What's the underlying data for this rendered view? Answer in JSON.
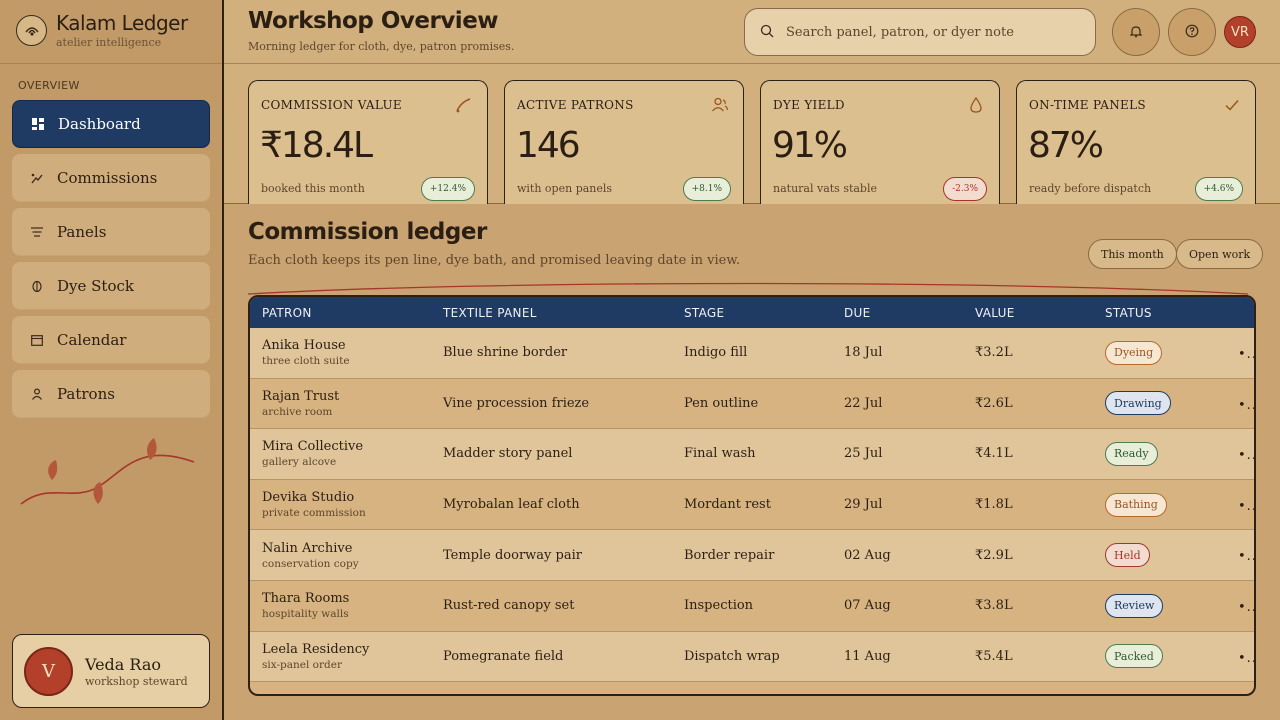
{
  "brand": {
    "name": "Kalam Ledger",
    "subtitle": "atelier intelligence"
  },
  "sidebar": {
    "section_label": "OVERVIEW",
    "items": [
      {
        "label": "Dashboard",
        "icon": "dashboard-icon",
        "active": true
      },
      {
        "label": "Commissions",
        "icon": "commissions-icon"
      },
      {
        "label": "Panels",
        "icon": "panels-icon"
      },
      {
        "label": "Dye Stock",
        "icon": "dye-stock-icon"
      },
      {
        "label": "Calendar",
        "icon": "calendar-icon"
      },
      {
        "label": "Patrons",
        "icon": "patrons-icon"
      }
    ]
  },
  "user": {
    "initial": "V",
    "name": "Veda Rao",
    "role": "workshop steward"
  },
  "header": {
    "title": "Workshop Overview",
    "subtitle": "Morning ledger for cloth, dye, patron promises.",
    "search_placeholder": "Search panel, patron, or dyer note",
    "avatar_initials": "VR"
  },
  "metrics": [
    {
      "label": "COMMISSION VALUE",
      "value": "₹18.4L",
      "note": "booked this month",
      "delta": "+12.4%",
      "trend": "up",
      "icon": "brush-icon"
    },
    {
      "label": "ACTIVE PATRONS",
      "value": "146",
      "note": "with open panels",
      "delta": "+8.1%",
      "trend": "up",
      "icon": "people-icon"
    },
    {
      "label": "DYE YIELD",
      "value": "91%",
      "note": "natural vats stable",
      "delta": "-2.3%",
      "trend": "down",
      "icon": "drop-icon"
    },
    {
      "label": "ON-TIME PANELS",
      "value": "87%",
      "note": "ready before dispatch",
      "delta": "+4.6%",
      "trend": "up",
      "icon": "check-icon"
    }
  ],
  "ledger": {
    "title": "Commission ledger",
    "subtitle": "Each cloth keeps its pen line, dye bath, and promised leaving date in view.",
    "filters": [
      "This month",
      "Open work"
    ],
    "columns": [
      "PATRON",
      "TEXTILE PANEL",
      "STAGE",
      "DUE",
      "VALUE",
      "STATUS"
    ],
    "rows": [
      {
        "patron": "Anika House",
        "patron_sub": "three cloth suite",
        "panel": "Blue shrine border",
        "stage": "Indigo fill",
        "due": "18 Jul",
        "value": "₹3.2L",
        "status": "Dyeing",
        "tone": "warm"
      },
      {
        "patron": "Rajan Trust",
        "patron_sub": "archive room",
        "panel": "Vine procession frieze",
        "stage": "Pen outline",
        "due": "22 Jul",
        "value": "₹2.6L",
        "status": "Drawing",
        "tone": "blue"
      },
      {
        "patron": "Mira Collective",
        "patron_sub": "gallery alcove",
        "panel": "Madder story panel",
        "stage": "Final wash",
        "due": "25 Jul",
        "value": "₹4.1L",
        "status": "Ready",
        "tone": "green"
      },
      {
        "patron": "Devika Studio",
        "patron_sub": "private commission",
        "panel": "Myrobalan leaf cloth",
        "stage": "Mordant rest",
        "due": "29 Jul",
        "value": "₹1.8L",
        "status": "Bathing",
        "tone": "warm"
      },
      {
        "patron": "Nalin Archive",
        "patron_sub": "conservation copy",
        "panel": "Temple doorway pair",
        "stage": "Border repair",
        "due": "02 Aug",
        "value": "₹2.9L",
        "status": "Held",
        "tone": "red"
      },
      {
        "patron": "Thara Rooms",
        "patron_sub": "hospitality walls",
        "panel": "Rust-red canopy set",
        "stage": "Inspection",
        "due": "07 Aug",
        "value": "₹3.8L",
        "status": "Review",
        "tone": "blue"
      },
      {
        "patron": "Leela Residency",
        "patron_sub": "six-panel order",
        "panel": "Pomegranate field",
        "stage": "Dispatch wrap",
        "due": "11 Aug",
        "value": "₹5.4L",
        "status": "Packed",
        "tone": "green"
      }
    ]
  },
  "colors": {
    "accent": "#1f3a63",
    "brand_red": "#b3402a",
    "background": "#c9a472"
  }
}
